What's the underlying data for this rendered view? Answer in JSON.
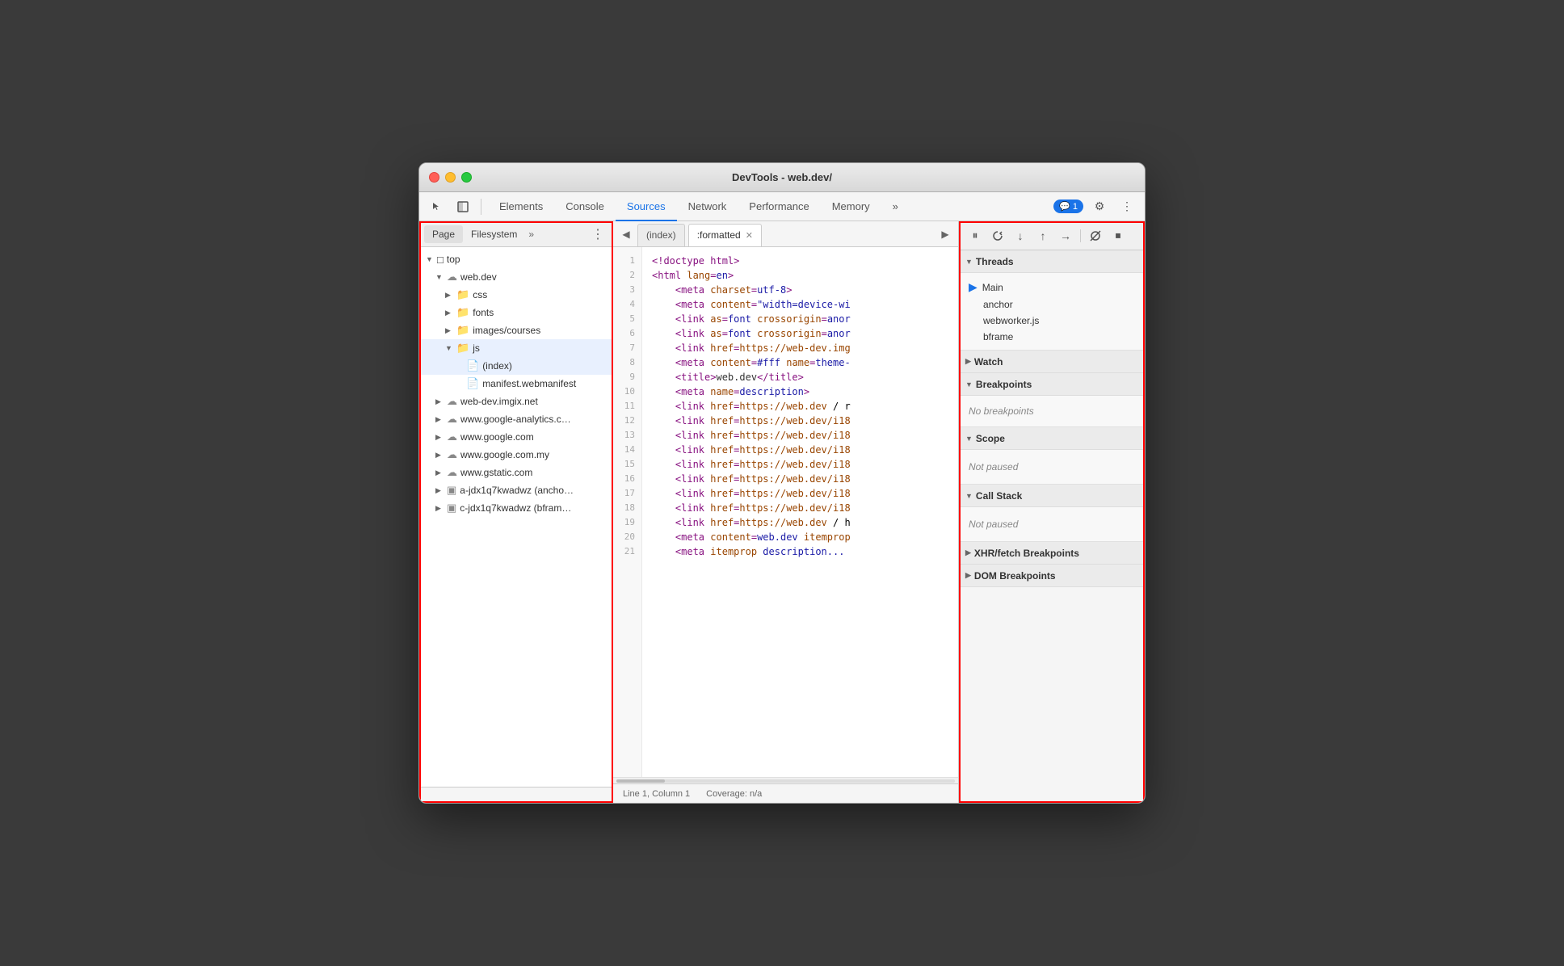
{
  "window": {
    "title": "DevTools - web.dev/"
  },
  "toolbar": {
    "tabs": [
      {
        "label": "Elements",
        "active": false
      },
      {
        "label": "Console",
        "active": false
      },
      {
        "label": "Sources",
        "active": true
      },
      {
        "label": "Network",
        "active": false
      },
      {
        "label": "Performance",
        "active": false
      },
      {
        "label": "Memory",
        "active": false
      },
      {
        "label": "»",
        "active": false
      }
    ],
    "notification_count": "1",
    "notification_icon": "💬"
  },
  "left_panel": {
    "tabs": [
      {
        "label": "Page",
        "active": true
      },
      {
        "label": "Filesystem",
        "active": false
      },
      {
        "label": "»",
        "active": false
      }
    ],
    "tree": [
      {
        "level": 1,
        "type": "folder_open",
        "label": "top",
        "has_arrow": true
      },
      {
        "level": 2,
        "type": "cloud",
        "label": "web.dev",
        "has_arrow": true
      },
      {
        "level": 3,
        "type": "folder",
        "label": "css",
        "has_arrow": true
      },
      {
        "level": 3,
        "type": "folder",
        "label": "fonts",
        "has_arrow": true
      },
      {
        "level": 3,
        "type": "folder",
        "label": "images/courses",
        "has_arrow": true
      },
      {
        "level": 3,
        "type": "folder",
        "label": "js",
        "has_arrow": true,
        "selected": true
      },
      {
        "level": 4,
        "type": "file",
        "label": "(index)",
        "selected": true
      },
      {
        "level": 4,
        "type": "file",
        "label": "manifest.webmanifest"
      },
      {
        "level": 2,
        "type": "cloud",
        "label": "web-dev.imgix.net",
        "has_arrow": true
      },
      {
        "level": 2,
        "type": "cloud",
        "label": "www.google-analytics.c…",
        "has_arrow": true
      },
      {
        "level": 2,
        "type": "cloud",
        "label": "www.google.com",
        "has_arrow": true
      },
      {
        "level": 2,
        "type": "cloud",
        "label": "www.google.com.my",
        "has_arrow": true
      },
      {
        "level": 2,
        "type": "cloud",
        "label": "www.gstatic.com",
        "has_arrow": true
      },
      {
        "level": 2,
        "type": "frame",
        "label": "a-jdx1q7kwadwz (ancho…",
        "has_arrow": true
      },
      {
        "level": 2,
        "type": "frame",
        "label": "c-jdx1q7kwadwz (bfram…",
        "has_arrow": true
      }
    ]
  },
  "editor": {
    "tabs": [
      {
        "label": "(index)",
        "active": false
      },
      {
        "label": ":formatted",
        "active": true,
        "closeable": true
      }
    ],
    "lines": [
      {
        "num": 1,
        "content": "<!doctype html>"
      },
      {
        "num": 2,
        "content": "<html lang=en>"
      },
      {
        "num": 3,
        "content": "    <meta charset=utf-8>"
      },
      {
        "num": 4,
        "content": "    <meta content=\"width=device-wi"
      },
      {
        "num": 5,
        "content": "    <link as=font crossorigin=anor"
      },
      {
        "num": 6,
        "content": "    <link as=font crossorigin=anor"
      },
      {
        "num": 7,
        "content": "    <link href=https://web-dev.img"
      },
      {
        "num": 8,
        "content": "    <meta content=#fff name=theme-"
      },
      {
        "num": 9,
        "content": "    <title>web.dev</title>"
      },
      {
        "num": 10,
        "content": "    <meta name=description>"
      },
      {
        "num": 11,
        "content": "    <link href=https://web.dev / r"
      },
      {
        "num": 12,
        "content": "    <link href=https://web.dev/i18"
      },
      {
        "num": 13,
        "content": "    <link href=https://web.dev/i18"
      },
      {
        "num": 14,
        "content": "    <link href=https://web.dev/i18"
      },
      {
        "num": 15,
        "content": "    <link href=https://web.dev/i18"
      },
      {
        "num": 16,
        "content": "    <link href=https://web.dev/i18"
      },
      {
        "num": 17,
        "content": "    <link href=https://web.dev/i18"
      },
      {
        "num": 18,
        "content": "    <link href=https://web.dev/i18"
      },
      {
        "num": 19,
        "content": "    <link href=https://web.dev / h"
      },
      {
        "num": 20,
        "content": "    <meta content=web.dev itemprop"
      },
      {
        "num": 21,
        "content": "    <meta itemprop description..."
      }
    ],
    "status": {
      "position": "Line 1, Column 1",
      "coverage": "Coverage: n/a"
    }
  },
  "right_panel": {
    "debug_buttons": [
      {
        "icon": "⏸",
        "title": "Pause"
      },
      {
        "icon": "↺",
        "title": "Step over"
      },
      {
        "icon": "↓",
        "title": "Step into"
      },
      {
        "icon": "↑",
        "title": "Step out"
      },
      {
        "icon": "⇒",
        "title": "Step"
      },
      {
        "icon": "✏",
        "title": "Deactivate breakpoints"
      },
      {
        "icon": "⏹",
        "title": "Don't pause on exceptions"
      }
    ],
    "sections": [
      {
        "label": "Threads",
        "expanded": true,
        "items": [
          {
            "label": "Main",
            "active": true
          },
          {
            "label": "anchor"
          },
          {
            "label": "webworker.js"
          },
          {
            "label": "bframe"
          }
        ]
      },
      {
        "label": "Watch",
        "expanded": false,
        "items": []
      },
      {
        "label": "Breakpoints",
        "expanded": true,
        "items": [],
        "empty_text": "No breakpoints"
      },
      {
        "label": "Scope",
        "expanded": true,
        "items": [],
        "empty_text": "Not paused"
      },
      {
        "label": "Call Stack",
        "expanded": true,
        "items": [],
        "empty_text": "Not paused"
      },
      {
        "label": "XHR/fetch Breakpoints",
        "expanded": false,
        "items": []
      },
      {
        "label": "DOM Breakpoints",
        "expanded": false,
        "items": []
      }
    ]
  }
}
